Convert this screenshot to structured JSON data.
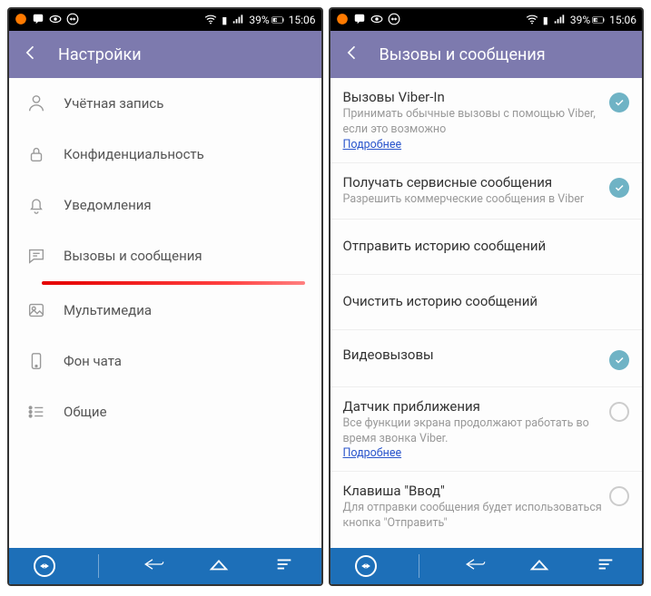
{
  "statusbar": {
    "battery_percent": "39%",
    "time": "15:06"
  },
  "left": {
    "appbar_title": "Настройки",
    "items": [
      {
        "label": "Учётная запись"
      },
      {
        "label": "Конфиденциальность"
      },
      {
        "label": "Уведомления"
      },
      {
        "label": "Вызовы и сообщения"
      },
      {
        "label": "Мультимедиа"
      },
      {
        "label": "Фон чата"
      },
      {
        "label": "Общие"
      }
    ]
  },
  "right": {
    "appbar_title": "Вызовы и сообщения",
    "items": [
      {
        "title": "Вызовы Viber-In",
        "sub": "Принимать обычные вызовы с помощью Viber, если это возможно",
        "link": "Подробнее",
        "checked": true
      },
      {
        "title": "Получать сервисные сообщения",
        "sub": "Разрешить коммерческие сообщения в Viber",
        "checked": true
      },
      {
        "title": "Отправить историю сообщений"
      },
      {
        "title": "Очистить историю сообщений"
      },
      {
        "title": "Видеовызовы",
        "checked": true
      },
      {
        "title": "Датчик приближения",
        "sub": "Все функции экрана продолжают работать во время звонка Viber.",
        "link": "Подробнее",
        "checked": false
      },
      {
        "title": "Клавиша \"Ввод\"",
        "sub": "Для отправки сообщения будет использоваться кнопка \"Отправить\"",
        "checked": false
      }
    ]
  }
}
